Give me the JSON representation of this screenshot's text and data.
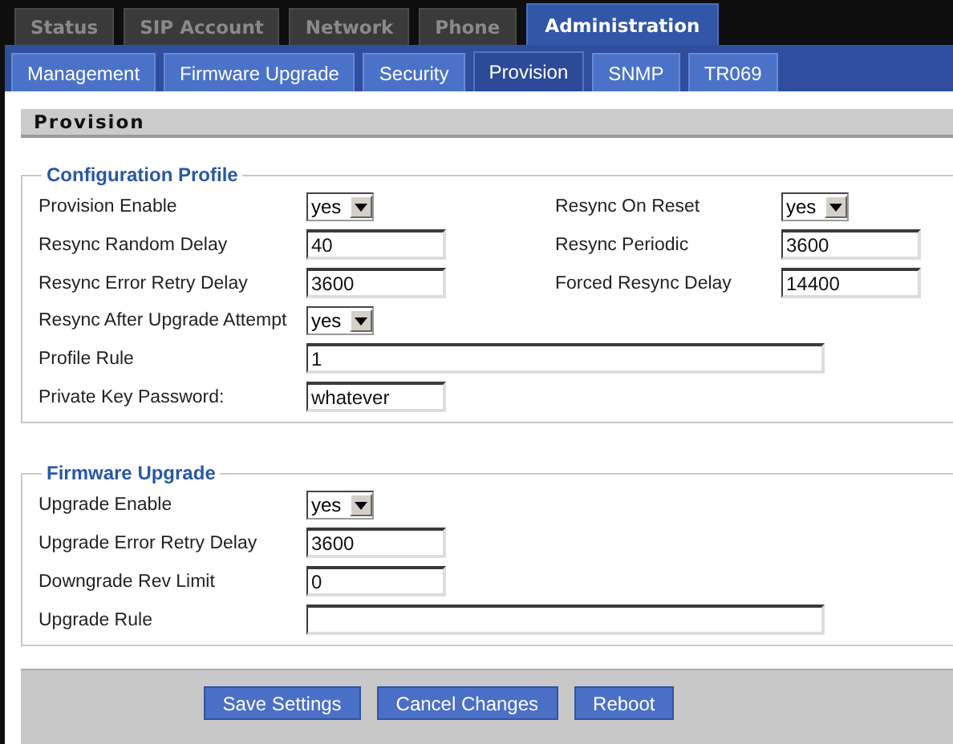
{
  "main_tabs": [
    {
      "label": "Status",
      "selected": false
    },
    {
      "label": "SIP Account",
      "selected": false
    },
    {
      "label": "Network",
      "selected": false
    },
    {
      "label": "Phone",
      "selected": false
    },
    {
      "label": "Administration",
      "selected": true
    }
  ],
  "sub_tabs": [
    {
      "label": "Management",
      "selected": false
    },
    {
      "label": "Firmware Upgrade",
      "selected": false
    },
    {
      "label": "Security",
      "selected": false
    },
    {
      "label": "Provision",
      "selected": true
    },
    {
      "label": "SNMP",
      "selected": false
    },
    {
      "label": "TR069",
      "selected": false
    }
  ],
  "page_title": "Provision",
  "sections": [
    {
      "title": "Configuration Profile",
      "rows": [
        {
          "fields": [
            {
              "label": "Provision Enable",
              "kind": "select",
              "value": "yes"
            },
            {
              "label": "Resync On Reset",
              "kind": "select",
              "value": "yes"
            }
          ]
        },
        {
          "fields": [
            {
              "label": "Resync Random Delay",
              "kind": "text",
              "value": "40"
            },
            {
              "label": "Resync Periodic",
              "kind": "text",
              "value": "3600"
            }
          ]
        },
        {
          "fields": [
            {
              "label": "Resync Error Retry Delay",
              "kind": "text",
              "value": "3600"
            },
            {
              "label": "Forced Resync Delay",
              "kind": "text",
              "value": "14400"
            }
          ]
        },
        {
          "fields": [
            {
              "label": "Resync After Upgrade Attempt",
              "kind": "select",
              "value": "yes"
            }
          ]
        },
        {
          "fields": [
            {
              "label": "Profile Rule",
              "kind": "wide",
              "value": "1"
            }
          ]
        },
        {
          "fields": [
            {
              "label": "Private Key Password:",
              "kind": "text",
              "value": "whatever"
            }
          ]
        }
      ]
    },
    {
      "title": "Firmware Upgrade",
      "rows": [
        {
          "fields": [
            {
              "label": "Upgrade Enable",
              "kind": "select",
              "value": "yes"
            }
          ]
        },
        {
          "fields": [
            {
              "label": "Upgrade Error Retry Delay",
              "kind": "text",
              "value": "3600"
            }
          ]
        },
        {
          "fields": [
            {
              "label": "Downgrade Rev Limit",
              "kind": "text",
              "value": "0"
            }
          ]
        },
        {
          "fields": [
            {
              "label": "Upgrade Rule",
              "kind": "wide"
            }
          ]
        }
      ]
    }
  ],
  "buttons": [
    "Save Settings",
    "Cancel Changes",
    "Reboot"
  ]
}
